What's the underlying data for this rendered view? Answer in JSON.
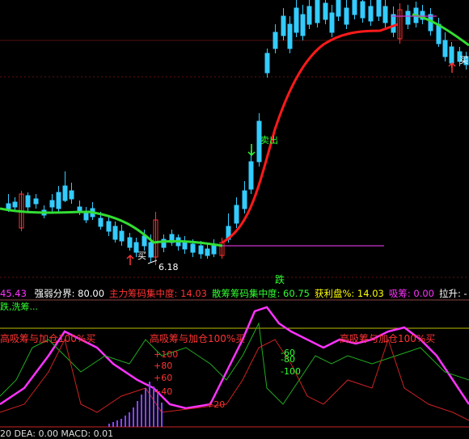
{
  "upper": {
    "sell_label": "卖出",
    "buy_label": "买",
    "buy_label_right": "买",
    "low_price": "6.18",
    "fall_label": "跌"
  },
  "info_bar": {
    "first_value": "45.43",
    "items": [
      {
        "label": "强弱分界: ",
        "value": "80.00",
        "color": "#ffffff"
      },
      {
        "label": "主力筹码集中度: ",
        "value": "14.03",
        "color": "#ff3333"
      },
      {
        "label": "散筹筹码集中度: ",
        "value": "60.75",
        "color": "#33ff33"
      },
      {
        "label": "获利盘%: ",
        "value": "14.03",
        "color": "#ffff00"
      },
      {
        "label": "吸筹: ",
        "value": "0.00",
        "color": "#ff33ff"
      },
      {
        "label": "拉升: ",
        "value": "-",
        "color": "#ffffff"
      },
      {
        "label": "警",
        "value": "",
        "color": "#ffff00"
      }
    ]
  },
  "lower": {
    "top_green_text": "跌,洗筹...",
    "red_banner": "高吸筹与加仓100%买",
    "labels": [
      "+100",
      "+80",
      "+60",
      "+40",
      "+20",
      "-60",
      "-80",
      "-100"
    ]
  },
  "bottom_bar": {
    "text": "20 DEA: 0.00   MACD: 0.01"
  },
  "colors": {
    "bg": "#000000",
    "up": "#ff3333",
    "down": "#33ccff",
    "ma": "#ff1a1a",
    "support": "#33dd33",
    "magenta": "#ff33ff",
    "green": "#33ff33",
    "yellow": "#ffff00"
  }
}
